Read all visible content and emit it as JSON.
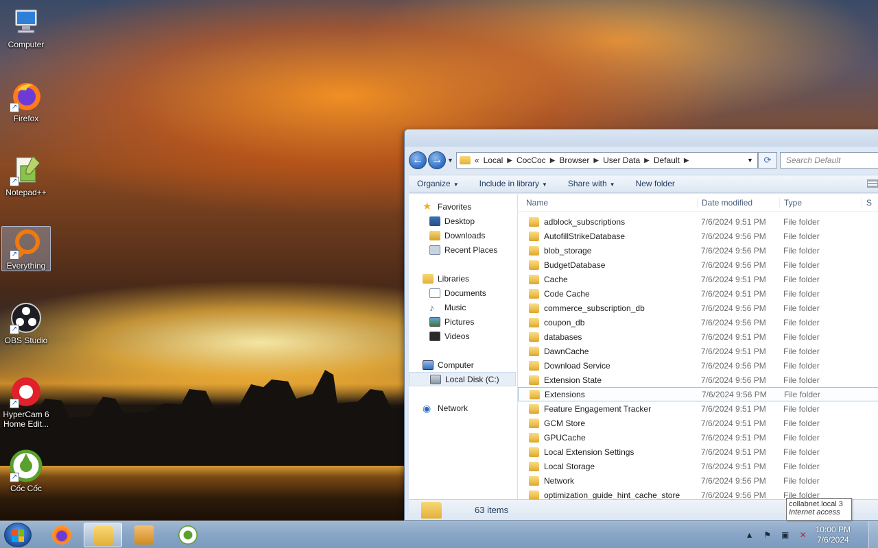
{
  "desktop": {
    "icons": [
      {
        "label": "Computer",
        "icon": "computer-icon"
      },
      {
        "label": "Firefox",
        "icon": "firefox-icon"
      },
      {
        "label": "Notepad++",
        "icon": "notepad-plus-plus-icon"
      },
      {
        "label": "Everything",
        "icon": "everything-search-icon"
      },
      {
        "label": "OBS Studio",
        "icon": "obs-studio-icon"
      },
      {
        "label": "HyperCam 6",
        "label2": "Home Edit...",
        "icon": "hypercam-icon"
      },
      {
        "label": "Cốc Cốc",
        "icon": "coccoc-icon"
      }
    ]
  },
  "explorer": {
    "address": {
      "overflow": "«",
      "crumbs": [
        "Local",
        "CocCoc",
        "Browser",
        "User Data",
        "Default"
      ]
    },
    "search_placeholder": "Search Default",
    "toolbar": {
      "organize": "Organize",
      "include_in_library": "Include in library",
      "share_with": "Share with",
      "new_folder": "New folder"
    },
    "nav": {
      "favorites": "Favorites",
      "desktop": "Desktop",
      "downloads": "Downloads",
      "recent_places": "Recent Places",
      "libraries": "Libraries",
      "documents": "Documents",
      "music": "Music",
      "pictures": "Pictures",
      "videos": "Videos",
      "computer": "Computer",
      "local_disk": "Local Disk (C:)",
      "network": "Network"
    },
    "columns": {
      "name": "Name",
      "date": "Date modified",
      "type": "Type",
      "size": "S"
    },
    "files": [
      {
        "name": "adblock_subscriptions",
        "date": "7/6/2024 9:51 PM",
        "type": "File folder"
      },
      {
        "name": "AutofillStrikeDatabase",
        "date": "7/6/2024 9:56 PM",
        "type": "File folder"
      },
      {
        "name": "blob_storage",
        "date": "7/6/2024 9:56 PM",
        "type": "File folder"
      },
      {
        "name": "BudgetDatabase",
        "date": "7/6/2024 9:56 PM",
        "type": "File folder"
      },
      {
        "name": "Cache",
        "date": "7/6/2024 9:51 PM",
        "type": "File folder"
      },
      {
        "name": "Code Cache",
        "date": "7/6/2024 9:51 PM",
        "type": "File folder"
      },
      {
        "name": "commerce_subscription_db",
        "date": "7/6/2024 9:56 PM",
        "type": "File folder"
      },
      {
        "name": "coupon_db",
        "date": "7/6/2024 9:56 PM",
        "type": "File folder"
      },
      {
        "name": "databases",
        "date": "7/6/2024 9:51 PM",
        "type": "File folder"
      },
      {
        "name": "DawnCache",
        "date": "7/6/2024 9:51 PM",
        "type": "File folder"
      },
      {
        "name": "Download Service",
        "date": "7/6/2024 9:56 PM",
        "type": "File folder"
      },
      {
        "name": "Extension State",
        "date": "7/6/2024 9:56 PM",
        "type": "File folder"
      },
      {
        "name": "Extensions",
        "date": "7/6/2024 9:56 PM",
        "type": "File folder"
      },
      {
        "name": "Feature Engagement Tracker",
        "date": "7/6/2024 9:51 PM",
        "type": "File folder"
      },
      {
        "name": "GCM Store",
        "date": "7/6/2024 9:51 PM",
        "type": "File folder"
      },
      {
        "name": "GPUCache",
        "date": "7/6/2024 9:51 PM",
        "type": "File folder"
      },
      {
        "name": "Local Extension Settings",
        "date": "7/6/2024 9:51 PM",
        "type": "File folder"
      },
      {
        "name": "Local Storage",
        "date": "7/6/2024 9:51 PM",
        "type": "File folder"
      },
      {
        "name": "Network",
        "date": "7/6/2024 9:56 PM",
        "type": "File folder"
      },
      {
        "name": "optimization_guide_hint_cache_store",
        "date": "7/6/2024 9:56 PM",
        "type": "File folder"
      }
    ],
    "status": {
      "items_count": "63 items"
    }
  },
  "tooltip": {
    "line1": "collabnet.local  3",
    "line2": "Internet access"
  },
  "taskbar": {
    "pinned": [
      "firefox-icon",
      "windows-explorer-icon",
      "media-player-icon",
      "coccoc-icon"
    ],
    "clock_time": "10:00 PM",
    "clock_date": "7/6/2024"
  }
}
